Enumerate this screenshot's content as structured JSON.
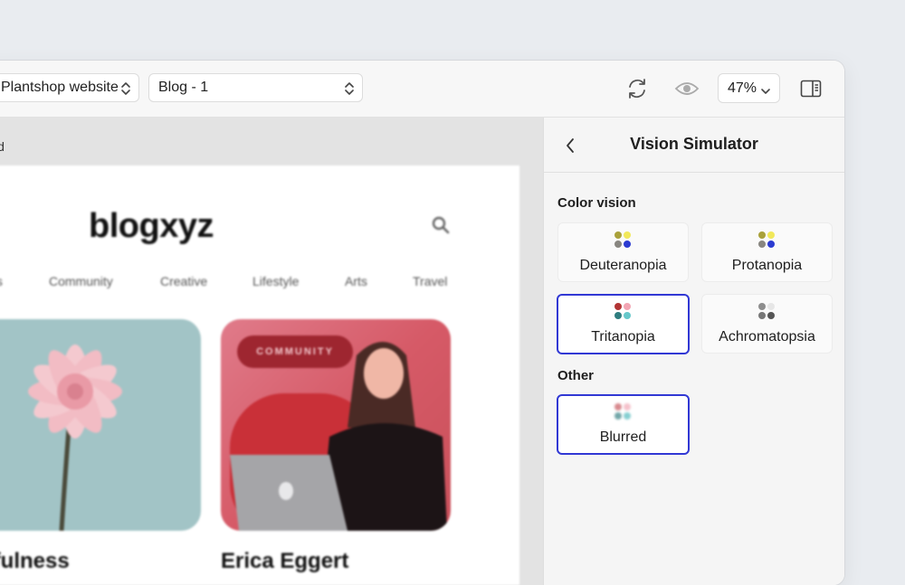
{
  "toolbar": {
    "site_select": {
      "value": "Plantshop website",
      "icon": "chevron-up-down-icon"
    },
    "page_select": {
      "value": "Blog - 1",
      "icon": "chevron-up-down-icon"
    },
    "refresh_icon": "refresh-icon",
    "preview_icon": "eye-icon",
    "zoom": {
      "value": "47%",
      "icon": "chevron-down-icon"
    },
    "panel_toggle_icon": "sidebar-toggle-icon"
  },
  "canvas": {
    "mode_label": "rred",
    "preview": {
      "logo": "blogxyz",
      "nav": [
        "ts",
        "Community",
        "Creative",
        "Lifestyle",
        "Arts",
        "Travel"
      ],
      "cards": [
        {
          "title": "dfulness",
          "badge": ""
        },
        {
          "title": "Erica Eggert",
          "badge": "COMMUNITY"
        }
      ]
    }
  },
  "panel": {
    "title": "Vision Simulator",
    "sections": [
      {
        "label": "Color vision",
        "options": [
          {
            "label": "Deuteranopia",
            "colors": [
              "#a9a13a",
              "#f1e85a",
              "#888680",
              "#2b3bd1"
            ],
            "selected": false
          },
          {
            "label": "Protanopia",
            "colors": [
              "#a9a13a",
              "#f1e85a",
              "#888680",
              "#2b3bd1"
            ],
            "selected": false
          },
          {
            "label": "Tritanopia",
            "colors": [
              "#b23434",
              "#f2a5b3",
              "#2f7d7f",
              "#66c8ca"
            ],
            "selected": true
          },
          {
            "label": "Achromatopsia",
            "colors": [
              "#8d8d8d",
              "#e6e6e6",
              "#777777",
              "#555555"
            ],
            "selected": false
          }
        ]
      },
      {
        "label": "Other",
        "options": [
          {
            "label": "Blurred",
            "colors": [
              "#d88a8f",
              "#f5c2cc",
              "#73a7a9",
              "#86cfd1"
            ],
            "selected": true
          }
        ]
      }
    ]
  },
  "colors": {
    "selection": "#3138d4",
    "panel_bg": "#f5f5f5",
    "canvas_bg": "#e3e3e3",
    "page_bg": "#e9ecf0"
  }
}
